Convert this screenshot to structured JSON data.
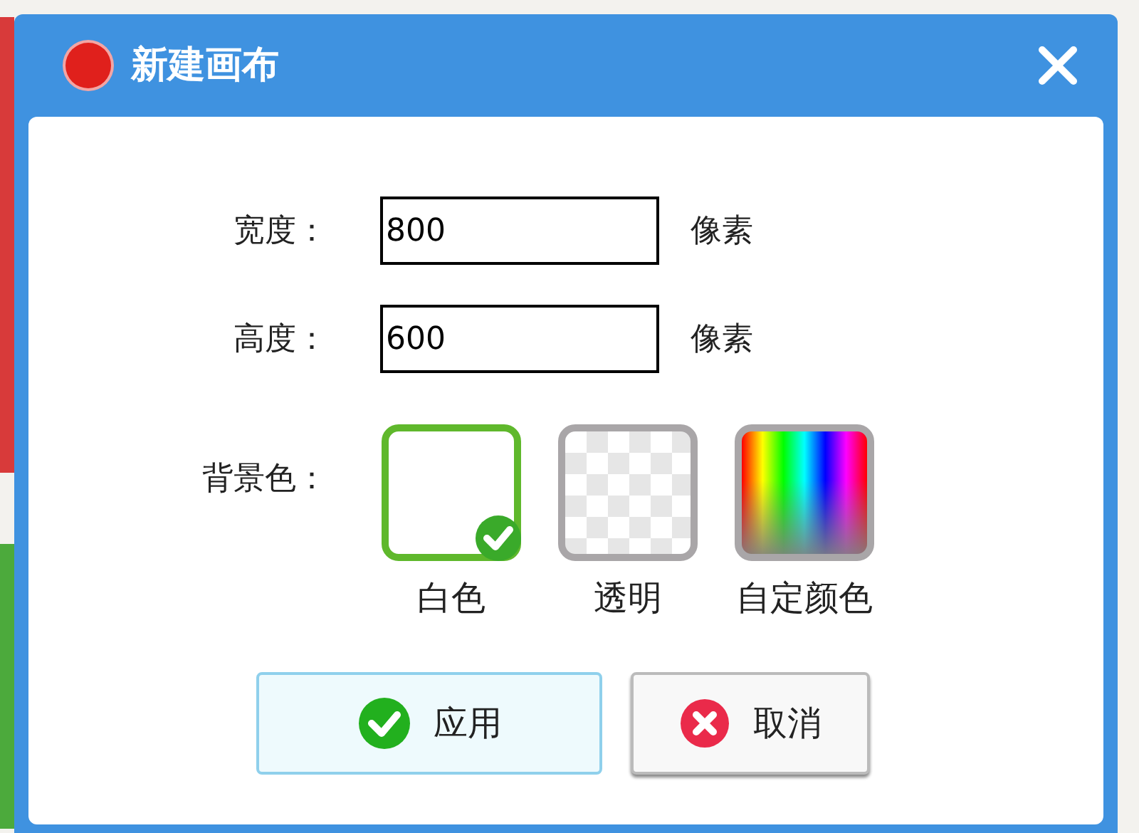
{
  "window": {
    "title": "新建画布"
  },
  "fields": [
    {
      "label": "宽度：",
      "value": "800",
      "unit": "像素"
    },
    {
      "label": "高度：",
      "value": "600",
      "unit": "像素"
    }
  ],
  "background": {
    "label": "背景色：",
    "options": [
      {
        "label": "白色",
        "kind": "white",
        "selected": true
      },
      {
        "label": "透明",
        "kind": "transparent",
        "selected": false
      },
      {
        "label": "自定颜色",
        "kind": "custom",
        "selected": false
      }
    ]
  },
  "buttons": [
    {
      "label": "应用",
      "kind": "apply"
    },
    {
      "label": "取消",
      "kind": "cancel"
    }
  ]
}
